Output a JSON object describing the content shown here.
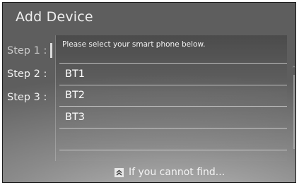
{
  "header": {
    "title": "Add Device"
  },
  "steps": [
    {
      "label": "Step 1 :"
    },
    {
      "label": "Step 2 :"
    },
    {
      "label": "Step 3 :"
    }
  ],
  "panel": {
    "instruction": "Please select your smart phone below.",
    "devices": [
      {
        "label": "BT1"
      },
      {
        "label": "BT2"
      },
      {
        "label": "BT3"
      }
    ]
  },
  "footer": {
    "find_label": "If you cannot find...",
    "find_icon": "double-chevron-up-icon"
  },
  "colors": {
    "text": "#f0f0f0",
    "inactive_step": "#c9c9c9",
    "divider": "#e1e1e1"
  }
}
